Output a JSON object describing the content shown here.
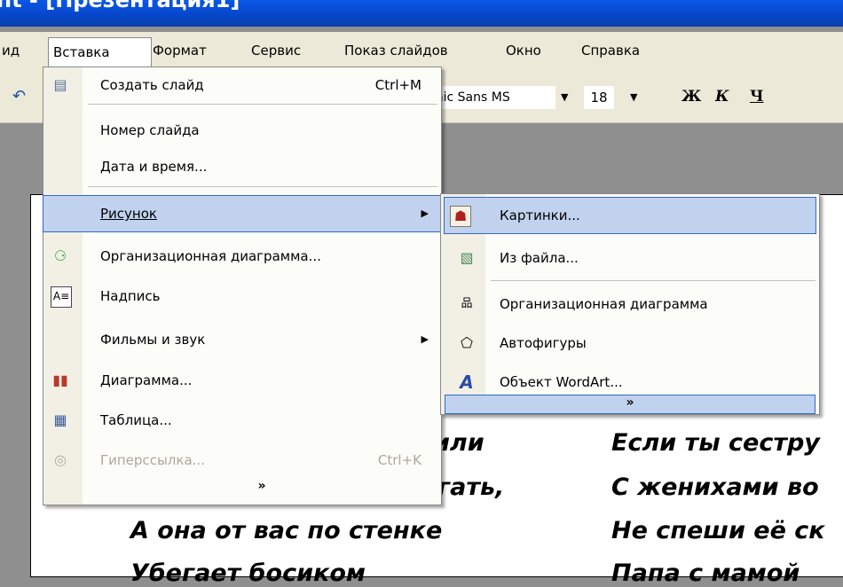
{
  "window": {
    "title_fragment": "nt - [Презентация1]"
  },
  "menubar": {
    "items": [
      "ид",
      "Вставка",
      "Формат",
      "Сервис",
      "Показ слайдов",
      "Окно",
      "Справка"
    ]
  },
  "toolbar": {
    "font_name": "mic Sans MS",
    "font_size": "18",
    "bold": "Ж",
    "italic": "К",
    "underline": "Ч"
  },
  "insert_menu": {
    "items": [
      {
        "label": "Создать слайд",
        "shortcut": "Ctrl+M",
        "icon": "new-slide-icon"
      },
      {
        "label": "Номер слайда"
      },
      {
        "label": "Дата и время..."
      },
      {
        "label": "Рисунок",
        "submenu": true
      },
      {
        "label": "Организационная диаграмма...",
        "icon": "org-chart-icon"
      },
      {
        "label": "Надпись",
        "icon": "textbox-icon"
      },
      {
        "label": "Фильмы и звук",
        "submenu": true
      },
      {
        "label": "Диаграмма...",
        "icon": "chart-icon"
      },
      {
        "label": "Таблица...",
        "icon": "table-icon"
      },
      {
        "label": "Гиперссылка...",
        "shortcut": "Ctrl+K",
        "icon": "hyperlink-icon",
        "disabled": true
      }
    ],
    "more": "»"
  },
  "picture_submenu": {
    "items": [
      {
        "label": "Картинки...",
        "icon": "clipart-icon"
      },
      {
        "label": "Из файла...",
        "icon": "from-file-icon"
      },
      {
        "label": "Организационная диаграмма",
        "icon": "org-chart-icon"
      },
      {
        "label": "Автофигуры",
        "icon": "autoshapes-icon"
      },
      {
        "label": "Объект WordArt...",
        "icon": "wordart-icon"
      }
    ],
    "more": "»"
  },
  "slide": {
    "left_lines": [
      "или",
      "гать,",
      "А она от вас по стенке",
      "Убегает босиком"
    ],
    "right_lines": [
      "Если ты сестру",
      "С женихами во",
      "Не спеши её ск",
      "Папа с мамой"
    ]
  },
  "colors": {
    "highlight": "#c1d2ee",
    "highlight_border": "#316ac5",
    "menubar": "#ece9d8"
  }
}
